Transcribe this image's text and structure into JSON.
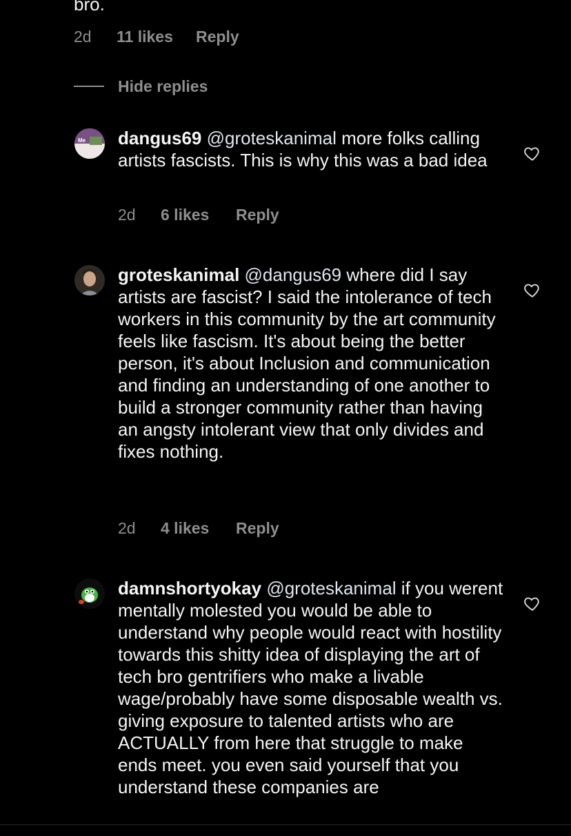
{
  "top_comment": {
    "tail_text": "bro.",
    "time": "2d",
    "likes": "11 likes",
    "reply": "Reply"
  },
  "hide_replies": "Hide replies",
  "replies": [
    {
      "username": "dangus69",
      "mention": "@groteskanimal",
      "body": " more folks calling artists fascists. This is why this was a bad idea",
      "time": "2d",
      "likes": "6 likes",
      "reply": "Reply"
    },
    {
      "username": "groteskanimal",
      "mention": "@dangus69",
      "body": " where did I say artists are fascist? I said the intolerance of tech workers in this community by the art community feels like fascism. It's about being the better person, it's about Inclusion and communication and finding an understanding of one another to build a stronger community rather than having an angsty intolerant view that only divides and fixes nothing.",
      "time": "2d",
      "likes": "4 likes",
      "reply": "Reply"
    },
    {
      "username": "damnshortyokay",
      "mention": "@groteskanimal",
      "body": " if you werent mentally molested you would be able to understand why people would react with hostility towards this shitty idea of displaying the art of tech bro gentrifiers who make a livable wage/probably have some disposable wealth vs. giving exposure to talented artists who are ACTUALLY from here that struggle to make ends meet. you even said yourself that you understand these companies are"
    }
  ],
  "avatar_text": "Me"
}
